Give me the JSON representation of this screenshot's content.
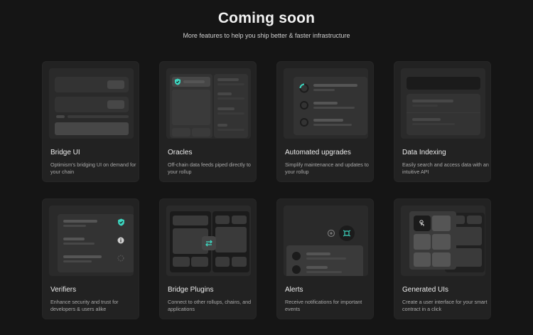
{
  "header": {
    "title": "Coming soon",
    "subtitle": "More features to help you ship better & faster infrastructure"
  },
  "colors": {
    "accent": "#3dd6c0",
    "background": "#151515",
    "card": "#222222"
  },
  "features": [
    {
      "name": "Bridge UI",
      "description": "Optimism's bridging UI on demand for your chain"
    },
    {
      "name": "Oracles",
      "description": "Off-chain data feeds piped directly to your rollup"
    },
    {
      "name": "Automated upgrades",
      "description": "Simplify maintenance and updates to your rollup"
    },
    {
      "name": "Data Indexing",
      "description": "Easily search and access data with an intuitive API"
    },
    {
      "name": "Verifiers",
      "description": "Enhance security and trust for developers & users alike"
    },
    {
      "name": "Bridge Plugins",
      "description": "Connect to other rollups, chains, and applications"
    },
    {
      "name": "Alerts",
      "description": "Receive notifications for important events"
    },
    {
      "name": "Generated UIs",
      "description": "Create a user interface for your smart contract in a click"
    }
  ]
}
